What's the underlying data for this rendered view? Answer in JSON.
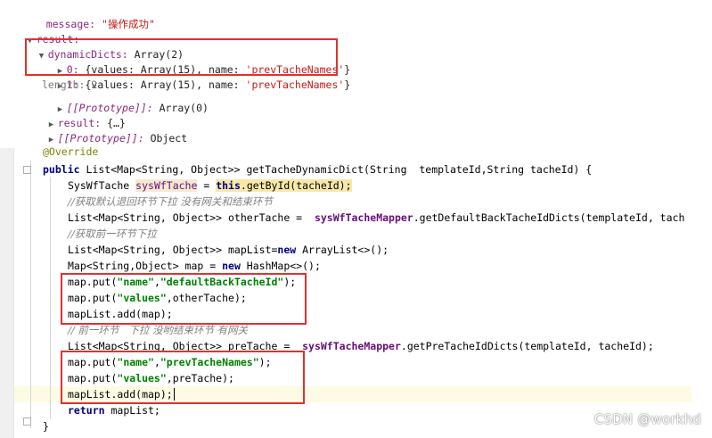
{
  "console": {
    "message_key": "message:",
    "message_value": "\"操作成功\"",
    "result_key": "result:",
    "dynamic_key": "dynamicDicts:",
    "dynamic_value": "Array(2)",
    "item0_index": "0:",
    "item0_text": "{values: Array(15), name: ",
    "item0_name": "'prevTacheNames'",
    "item0_close": "}",
    "item1_index": "1:",
    "item1_text": "{values: Array(15), name: ",
    "item1_name": "'prevTacheNames'",
    "item1_close": "}",
    "length_text": "length: 2",
    "proto_key": "[[Prototype]]:",
    "proto_value": "Array(0)",
    "result2_key": "result:",
    "result2_value": "{…}",
    "proto2_key": "[[Prototype]]:",
    "proto2_value": "Object"
  },
  "code": {
    "l0": "@Override",
    "l1_kw": "public",
    "l1_rest": " List<Map<String, Object>> getTacheDynamicDict(String  templateId,String tacheId) {",
    "l2_a": "SysWfTache ",
    "l2_var": "sysWfTache",
    "l2_b": " = ",
    "l2_kw": "this",
    "l2_c": ".getById(tacheId);",
    "l3": "//获取默认退回环节下拉 没有网关和结束环节",
    "l4_a": "List<Map<String, Object>> otherTache =  ",
    "l4_field": "sysWfTacheMapper",
    "l4_b": ".getDefaultBackTacheIdDicts(templateId, tach",
    "l5": "//获取前一环节下拉",
    "l6_a": "List<Map<String, Object>> mapList=",
    "l6_kw": "new",
    "l6_b": " ArrayList<>();",
    "l7_a": "Map<String,Object> map = ",
    "l7_kw": "new",
    "l7_b": " HashMap<>();",
    "l8_a": "map.put(",
    "l8_s1": "\"name\"",
    "l8_b": ",",
    "l8_s2": "\"defaultBackTacheId\"",
    "l8_c": ");",
    "l9_a": "map.put(",
    "l9_s1": "\"values\"",
    "l9_b": ",otherTache);",
    "l10": "mapList.add(map);",
    "l11": "// 前一环节   下拉 没哟结束环节 有网关",
    "l12_a": "List<Map<String, Object>> preTache =  ",
    "l12_field": "sysWfTacheMapper",
    "l12_b": ".getPreTacheIdDicts(templateId, tacheId);",
    "l13_a": "map.put(",
    "l13_s1": "\"name\"",
    "l13_b": ",",
    "l13_s2": "\"prevTacheNames\"",
    "l13_c": ");",
    "l14_a": "map.put(",
    "l14_s1": "\"values\"",
    "l14_b": ",preTache);",
    "l15": "mapList.add(map);",
    "l16_kw": "return",
    "l16_b": " mapList;",
    "l17": "}"
  },
  "watermark": "CSDN @workhd",
  "colors": {
    "highlight_box": "#e03131",
    "keyword": "#000080",
    "string": "#008000",
    "comment": "#808080",
    "console_key": "#8b2a7e",
    "console_string": "#c41a16"
  }
}
